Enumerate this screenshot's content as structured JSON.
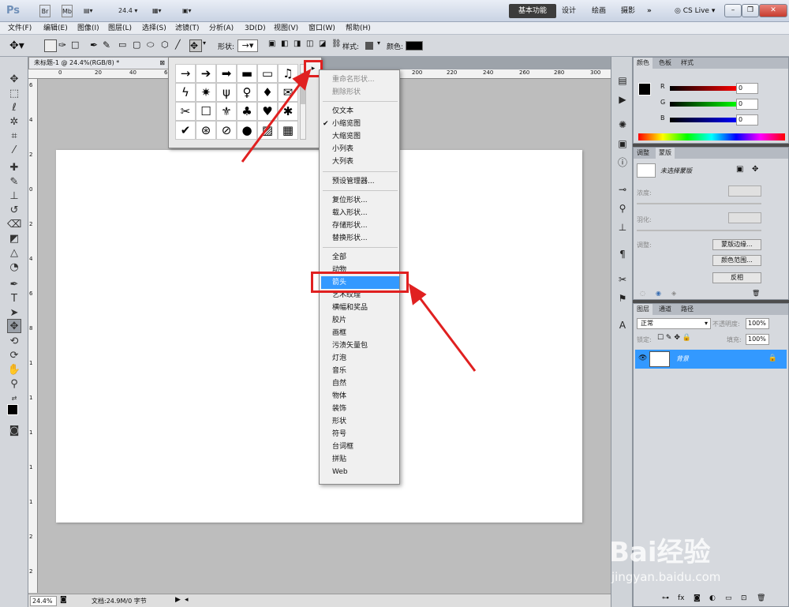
{
  "titlebar": {
    "app_logo": "Ps",
    "zoom": "24.4",
    "workspaces": [
      "基本功能",
      "设计",
      "绘画",
      "摄影"
    ],
    "more": "»",
    "cslive": "CS Live"
  },
  "menubar": {
    "items": [
      "文件(F)",
      "编辑(E)",
      "图像(I)",
      "图层(L)",
      "选择(S)",
      "滤镜(T)",
      "分析(A)",
      "3D(D)",
      "视图(V)",
      "窗口(W)",
      "帮助(H)"
    ]
  },
  "options": {
    "shape_label": "形状:",
    "style_label": "样式:",
    "color_label": "颜色:"
  },
  "document": {
    "tab_title": "未标题-1 @ 24.4%(RGB/8) *",
    "ruler_h": [
      "0",
      "20",
      "40",
      "60",
      "200",
      "220",
      "240",
      "260",
      "280",
      "300"
    ],
    "ruler_v": [
      "6",
      "4",
      "2",
      "0",
      "2",
      "4",
      "6",
      "8",
      "1",
      "1",
      "1",
      "1",
      "1",
      "2",
      "2",
      "2",
      "2"
    ]
  },
  "status": {
    "zoom": "24.4%",
    "doc_info": "文档:24.9M/0 字节"
  },
  "picker": {
    "shapes": [
      "→",
      "➔",
      "➡",
      "▬",
      "▭",
      "♫",
      "✉",
      "ϟ",
      "✷",
      "ψ",
      "♀",
      "♦",
      "ⵌ",
      "☐",
      "✂",
      "☐",
      "⚜",
      "♣",
      "♥",
      "✱",
      "✔",
      "⊛",
      "⊘",
      "●",
      "▨",
      "▦"
    ]
  },
  "context_menu": {
    "group1": [
      "重命名形状...",
      "删除形状"
    ],
    "group2": [
      "仅文本",
      "小缩览图",
      "大缩览图",
      "小列表",
      "大列表"
    ],
    "checked": "✔",
    "group3": [
      "预设管理器..."
    ],
    "group4": [
      "复位形状...",
      "载入形状...",
      "存储形状...",
      "替换形状..."
    ],
    "group5": [
      "全部",
      "动物",
      "箭头",
      "艺术纹理",
      "横幅和奖品",
      "胶片",
      "画框",
      "污渍矢量包",
      "灯泡",
      "音乐",
      "自然",
      "物体",
      "装饰",
      "形状",
      "符号",
      "台词框",
      "拼贴",
      "Web"
    ]
  },
  "color_panel": {
    "tabs": [
      "颜色",
      "色板",
      "样式"
    ],
    "r_label": "R",
    "g_label": "G",
    "b_label": "B",
    "r_value": "0",
    "g_value": "0",
    "b_value": "0"
  },
  "adjust_panel": {
    "tabs": [
      "调整",
      "蒙版"
    ],
    "no_mask": "未选择蒙版",
    "density": "浓度:",
    "feather": "羽化:",
    "refine": "调整:",
    "mask_edge": "蒙版边缘...",
    "color_range": "颜色范围...",
    "invert": "反相"
  },
  "layers_panel": {
    "tabs": [
      "图层",
      "通道",
      "路径"
    ],
    "blend_mode": "正常",
    "opacity_label": "不透明度:",
    "opacity_value": "100%",
    "lock_label": "锁定:",
    "fill_label": "填充:",
    "fill_value": "100%",
    "layer_name": "背景"
  },
  "watermark": {
    "brand": "Bai经验",
    "url": "jingyan.baidu.com"
  },
  "colors": {
    "highlight": "#3399ff",
    "annotation_red": "#e02020"
  }
}
